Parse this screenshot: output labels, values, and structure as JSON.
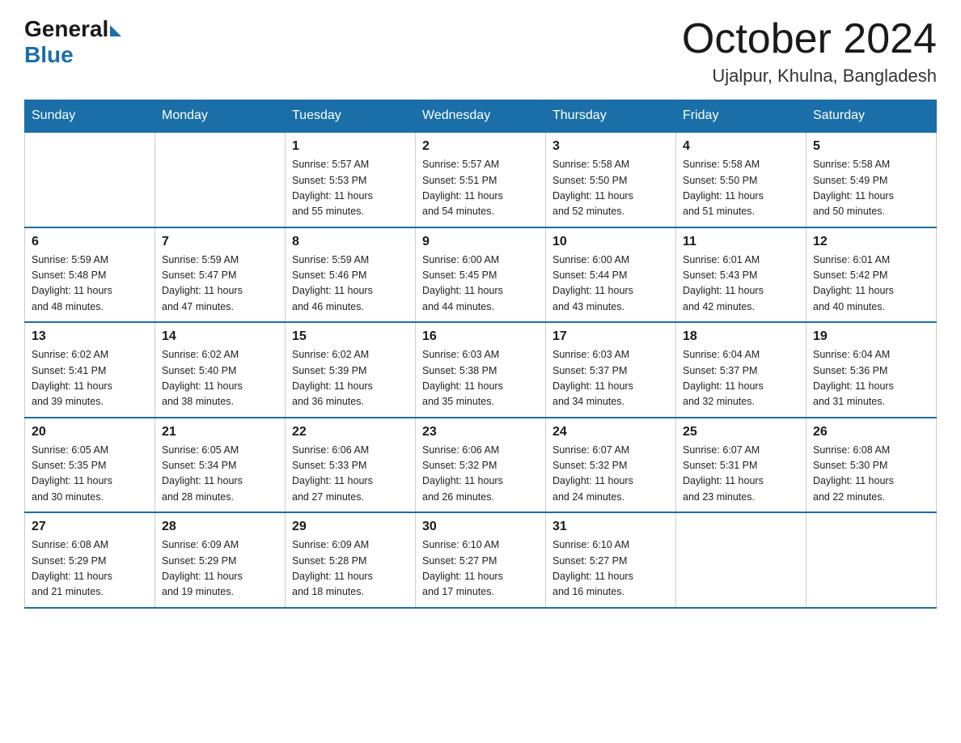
{
  "header": {
    "logo": {
      "general_text": "General",
      "blue_text": "Blue"
    },
    "title": "October 2024",
    "location": "Ujalpur, Khulna, Bangladesh"
  },
  "weekdays": [
    "Sunday",
    "Monday",
    "Tuesday",
    "Wednesday",
    "Thursday",
    "Friday",
    "Saturday"
  ],
  "weeks": [
    [
      {
        "day": "",
        "info": ""
      },
      {
        "day": "",
        "info": ""
      },
      {
        "day": "1",
        "info": "Sunrise: 5:57 AM\nSunset: 5:53 PM\nDaylight: 11 hours\nand 55 minutes."
      },
      {
        "day": "2",
        "info": "Sunrise: 5:57 AM\nSunset: 5:51 PM\nDaylight: 11 hours\nand 54 minutes."
      },
      {
        "day": "3",
        "info": "Sunrise: 5:58 AM\nSunset: 5:50 PM\nDaylight: 11 hours\nand 52 minutes."
      },
      {
        "day": "4",
        "info": "Sunrise: 5:58 AM\nSunset: 5:50 PM\nDaylight: 11 hours\nand 51 minutes."
      },
      {
        "day": "5",
        "info": "Sunrise: 5:58 AM\nSunset: 5:49 PM\nDaylight: 11 hours\nand 50 minutes."
      }
    ],
    [
      {
        "day": "6",
        "info": "Sunrise: 5:59 AM\nSunset: 5:48 PM\nDaylight: 11 hours\nand 48 minutes."
      },
      {
        "day": "7",
        "info": "Sunrise: 5:59 AM\nSunset: 5:47 PM\nDaylight: 11 hours\nand 47 minutes."
      },
      {
        "day": "8",
        "info": "Sunrise: 5:59 AM\nSunset: 5:46 PM\nDaylight: 11 hours\nand 46 minutes."
      },
      {
        "day": "9",
        "info": "Sunrise: 6:00 AM\nSunset: 5:45 PM\nDaylight: 11 hours\nand 44 minutes."
      },
      {
        "day": "10",
        "info": "Sunrise: 6:00 AM\nSunset: 5:44 PM\nDaylight: 11 hours\nand 43 minutes."
      },
      {
        "day": "11",
        "info": "Sunrise: 6:01 AM\nSunset: 5:43 PM\nDaylight: 11 hours\nand 42 minutes."
      },
      {
        "day": "12",
        "info": "Sunrise: 6:01 AM\nSunset: 5:42 PM\nDaylight: 11 hours\nand 40 minutes."
      }
    ],
    [
      {
        "day": "13",
        "info": "Sunrise: 6:02 AM\nSunset: 5:41 PM\nDaylight: 11 hours\nand 39 minutes."
      },
      {
        "day": "14",
        "info": "Sunrise: 6:02 AM\nSunset: 5:40 PM\nDaylight: 11 hours\nand 38 minutes."
      },
      {
        "day": "15",
        "info": "Sunrise: 6:02 AM\nSunset: 5:39 PM\nDaylight: 11 hours\nand 36 minutes."
      },
      {
        "day": "16",
        "info": "Sunrise: 6:03 AM\nSunset: 5:38 PM\nDaylight: 11 hours\nand 35 minutes."
      },
      {
        "day": "17",
        "info": "Sunrise: 6:03 AM\nSunset: 5:37 PM\nDaylight: 11 hours\nand 34 minutes."
      },
      {
        "day": "18",
        "info": "Sunrise: 6:04 AM\nSunset: 5:37 PM\nDaylight: 11 hours\nand 32 minutes."
      },
      {
        "day": "19",
        "info": "Sunrise: 6:04 AM\nSunset: 5:36 PM\nDaylight: 11 hours\nand 31 minutes."
      }
    ],
    [
      {
        "day": "20",
        "info": "Sunrise: 6:05 AM\nSunset: 5:35 PM\nDaylight: 11 hours\nand 30 minutes."
      },
      {
        "day": "21",
        "info": "Sunrise: 6:05 AM\nSunset: 5:34 PM\nDaylight: 11 hours\nand 28 minutes."
      },
      {
        "day": "22",
        "info": "Sunrise: 6:06 AM\nSunset: 5:33 PM\nDaylight: 11 hours\nand 27 minutes."
      },
      {
        "day": "23",
        "info": "Sunrise: 6:06 AM\nSunset: 5:32 PM\nDaylight: 11 hours\nand 26 minutes."
      },
      {
        "day": "24",
        "info": "Sunrise: 6:07 AM\nSunset: 5:32 PM\nDaylight: 11 hours\nand 24 minutes."
      },
      {
        "day": "25",
        "info": "Sunrise: 6:07 AM\nSunset: 5:31 PM\nDaylight: 11 hours\nand 23 minutes."
      },
      {
        "day": "26",
        "info": "Sunrise: 6:08 AM\nSunset: 5:30 PM\nDaylight: 11 hours\nand 22 minutes."
      }
    ],
    [
      {
        "day": "27",
        "info": "Sunrise: 6:08 AM\nSunset: 5:29 PM\nDaylight: 11 hours\nand 21 minutes."
      },
      {
        "day": "28",
        "info": "Sunrise: 6:09 AM\nSunset: 5:29 PM\nDaylight: 11 hours\nand 19 minutes."
      },
      {
        "day": "29",
        "info": "Sunrise: 6:09 AM\nSunset: 5:28 PM\nDaylight: 11 hours\nand 18 minutes."
      },
      {
        "day": "30",
        "info": "Sunrise: 6:10 AM\nSunset: 5:27 PM\nDaylight: 11 hours\nand 17 minutes."
      },
      {
        "day": "31",
        "info": "Sunrise: 6:10 AM\nSunset: 5:27 PM\nDaylight: 11 hours\nand 16 minutes."
      },
      {
        "day": "",
        "info": ""
      },
      {
        "day": "",
        "info": ""
      }
    ]
  ]
}
